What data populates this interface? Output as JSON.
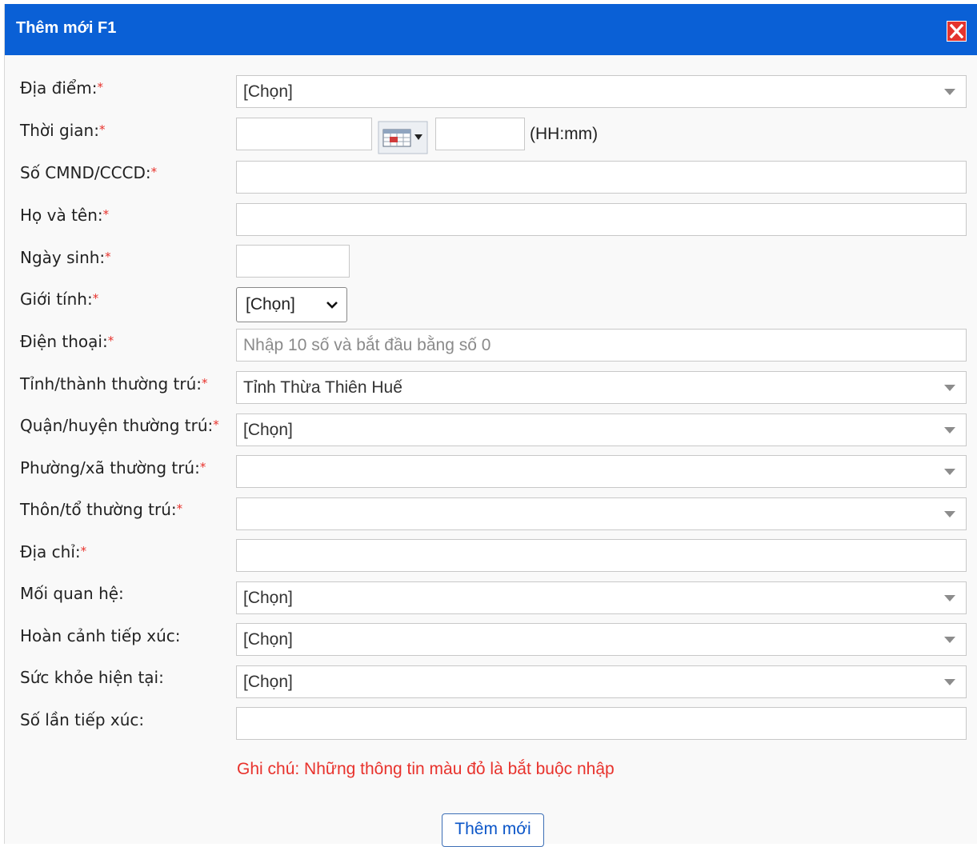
{
  "dialog": {
    "title": "Thêm mới F1",
    "close_icon": "close-icon"
  },
  "labels": {
    "dia_diem": "Địa điểm:",
    "thoi_gian": "Thời gian:",
    "cmnd": "Số CMND/CCCD:",
    "ho_ten": "Họ và tên:",
    "ngay_sinh": "Ngày sinh:",
    "gioi_tinh": "Giới tính:",
    "dien_thoai": "Điện thoại:",
    "tinh_thanh": "Tỉnh/thành thường trú:",
    "quan_huyen": "Quận/huyện thường trú:",
    "phuong_xa": "Phường/xã thường trú:",
    "thon_to": "Thôn/tổ thường trú:",
    "dia_chi": "Địa chỉ:",
    "moi_quan_he": "Mối quan hệ:",
    "hoan_canh": "Hoàn cảnh tiếp xúc:",
    "suc_khoe": "Sức khỏe hiện tại:",
    "so_lan": "Số lần tiếp xúc:"
  },
  "required_mark": "*",
  "values": {
    "dia_diem": "[Chọn]",
    "gioi_tinh": "[Chọn]",
    "dien_thoai_placeholder": "Nhập 10 số và bắt đầu bằng số 0",
    "tinh_thanh": "Tỉnh Thừa Thiên Huế",
    "quan_huyen": "[Chọn]",
    "phuong_xa": "",
    "thon_to": "",
    "moi_quan_he": "[Chọn]",
    "hoan_canh": "[Chọn]",
    "suc_khoe": "[Chọn]"
  },
  "time_hint": "(HH:mm)",
  "note": "Ghi chú: Những thông tin màu đỏ là bắt buộc nhập",
  "submit_label": "Thêm mới",
  "colors": {
    "titlebar": "#0a60d6",
    "required": "#e8322c",
    "close": "#e4342e"
  }
}
